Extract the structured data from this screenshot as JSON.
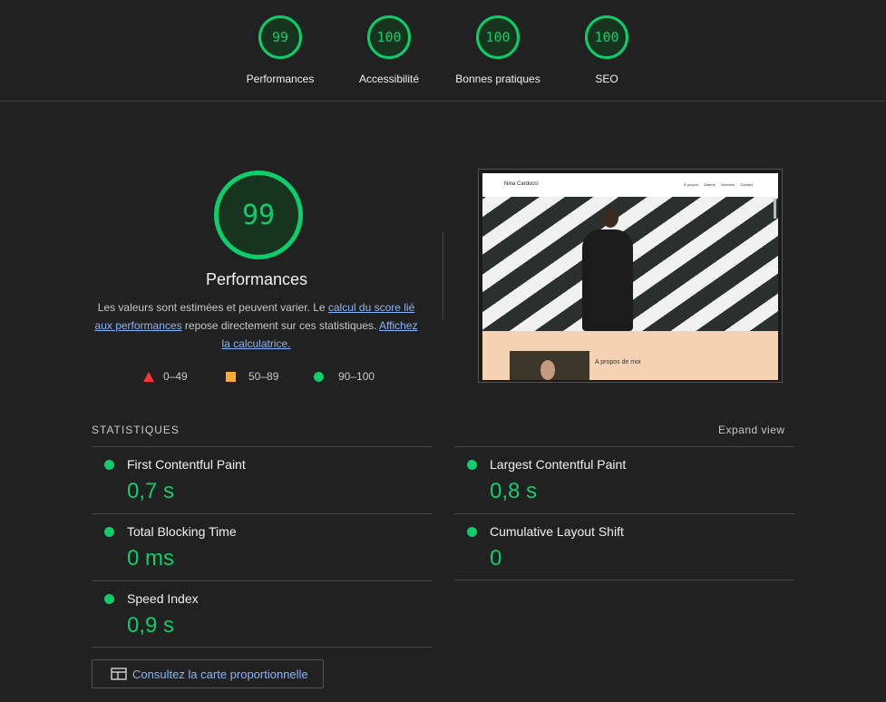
{
  "summary": [
    {
      "score": "99",
      "label": "Performances"
    },
    {
      "score": "100",
      "label": "Accessibilité"
    },
    {
      "score": "100",
      "label": "Bonnes pratiques"
    },
    {
      "score": "100",
      "label": "SEO"
    }
  ],
  "performance": {
    "score": "99",
    "title": "Performances",
    "desc_prefix": "Les valeurs sont estimées et peuvent varier. Le ",
    "desc_link1": "calcul du score lié aux performances",
    "desc_middle": " repose directement sur ces statistiques. ",
    "desc_link2": "Affichez la calculatrice."
  },
  "legend": {
    "fail": "0–49",
    "average": "50–89",
    "pass": "90–100"
  },
  "thumbnail": {
    "site_name": "Nina Carducci",
    "nav_links": [
      "À propos",
      "Galerie",
      "Services",
      "Contact"
    ],
    "about_heading": "A propos de moi"
  },
  "stats": {
    "title": "STATISTIQUES",
    "expand": "Expand view",
    "metrics": [
      {
        "name": "First Contentful Paint",
        "value": "0,7 s"
      },
      {
        "name": "Largest Contentful Paint",
        "value": "0,8 s"
      },
      {
        "name": "Total Blocking Time",
        "value": "0 ms"
      },
      {
        "name": "Cumulative Layout Shift",
        "value": "0"
      },
      {
        "name": "Speed Index",
        "value": "0,9 s"
      }
    ]
  },
  "treemap_button": "Consultez la carte proportionnelle",
  "colors": {
    "pass": "#0cce6b",
    "average": "#ffaa33",
    "fail": "#ff3333",
    "link": "#8ab4f8",
    "background": "#212121"
  }
}
